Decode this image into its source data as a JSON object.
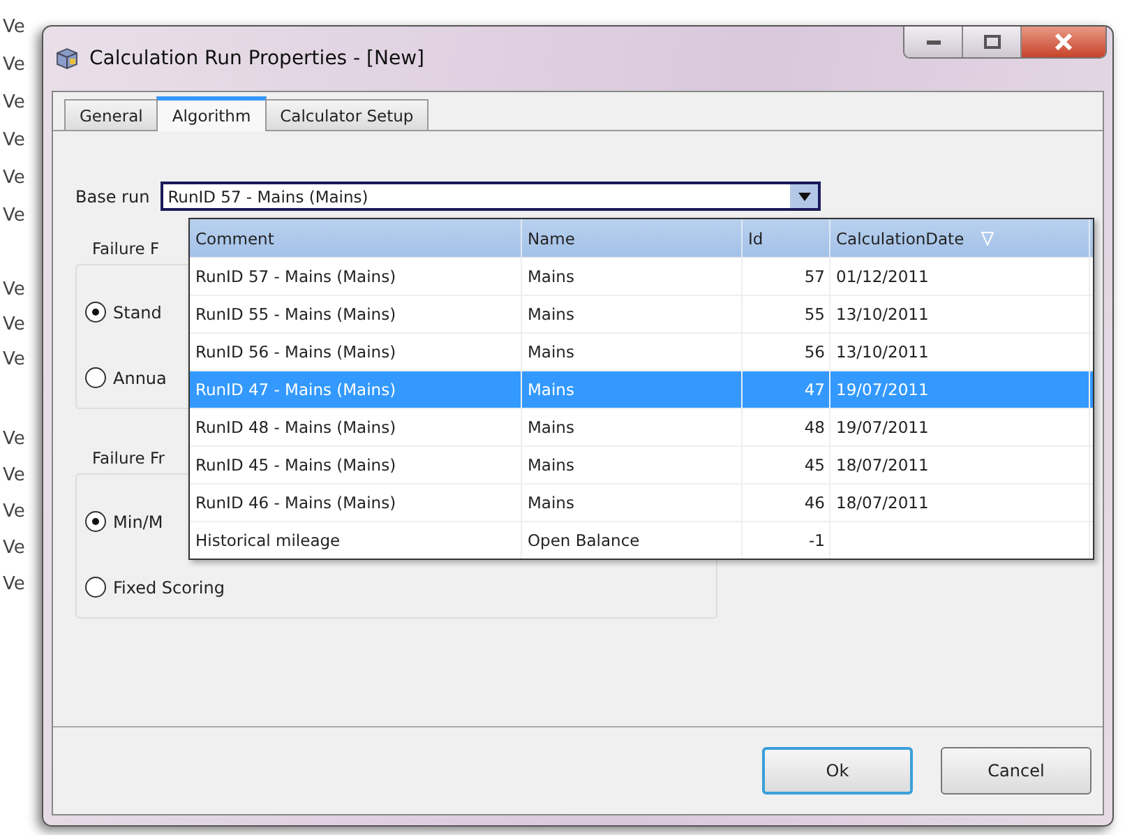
{
  "background_list": {
    "items": [
      "Ve",
      "Ve",
      "Ve",
      "Ve",
      "Ve",
      "Ve",
      "Ve",
      "Ve",
      "Ve",
      "Ve",
      "Ve",
      "Ve",
      "Ve",
      "Ve"
    ]
  },
  "window": {
    "title": "Calculation Run Properties - [New]"
  },
  "tabs": [
    {
      "label": "General",
      "selected": false
    },
    {
      "label": "Algorithm",
      "selected": true
    },
    {
      "label": "Calculator Setup",
      "selected": false
    }
  ],
  "base_run": {
    "label": "Base run",
    "value": "RunID 57 - Mains (Mains)"
  },
  "groups": [
    {
      "title": "Failure F",
      "options": [
        {
          "label": "Stand",
          "selected": true
        },
        {
          "label": "Annua",
          "selected": false
        }
      ]
    },
    {
      "title": "Failure Fr",
      "options": [
        {
          "label": "Min/M",
          "selected": true
        },
        {
          "label": "Fixed Scoring",
          "selected": false
        }
      ]
    }
  ],
  "dropdown": {
    "columns": [
      "Comment",
      "Name",
      "Id",
      "CalculationDate"
    ],
    "rows": [
      {
        "comment": "RunID 57 - Mains (Mains)",
        "name": "Mains",
        "id": "57",
        "date": "01/12/2011",
        "selected": false
      },
      {
        "comment": "RunID 55 - Mains (Mains)",
        "name": "Mains",
        "id": "55",
        "date": "13/10/2011",
        "selected": false
      },
      {
        "comment": "RunID 56 - Mains (Mains)",
        "name": "Mains",
        "id": "56",
        "date": "13/10/2011",
        "selected": false
      },
      {
        "comment": "RunID 47 - Mains (Mains)",
        "name": "Mains",
        "id": "47",
        "date": "19/07/2011",
        "selected": true
      },
      {
        "comment": "RunID 48 - Mains (Mains)",
        "name": "Mains",
        "id": "48",
        "date": "19/07/2011",
        "selected": false
      },
      {
        "comment": "RunID 45 - Mains (Mains)",
        "name": "Mains",
        "id": "45",
        "date": "18/07/2011",
        "selected": false
      },
      {
        "comment": "RunID 46 - Mains (Mains)",
        "name": "Mains",
        "id": "46",
        "date": "18/07/2011",
        "selected": false
      },
      {
        "comment": "Historical mileage",
        "name": "Open Balance",
        "id": "-1",
        "date": "",
        "selected": false
      }
    ]
  },
  "buttons": [
    "Ok",
    "Cancel"
  ]
}
